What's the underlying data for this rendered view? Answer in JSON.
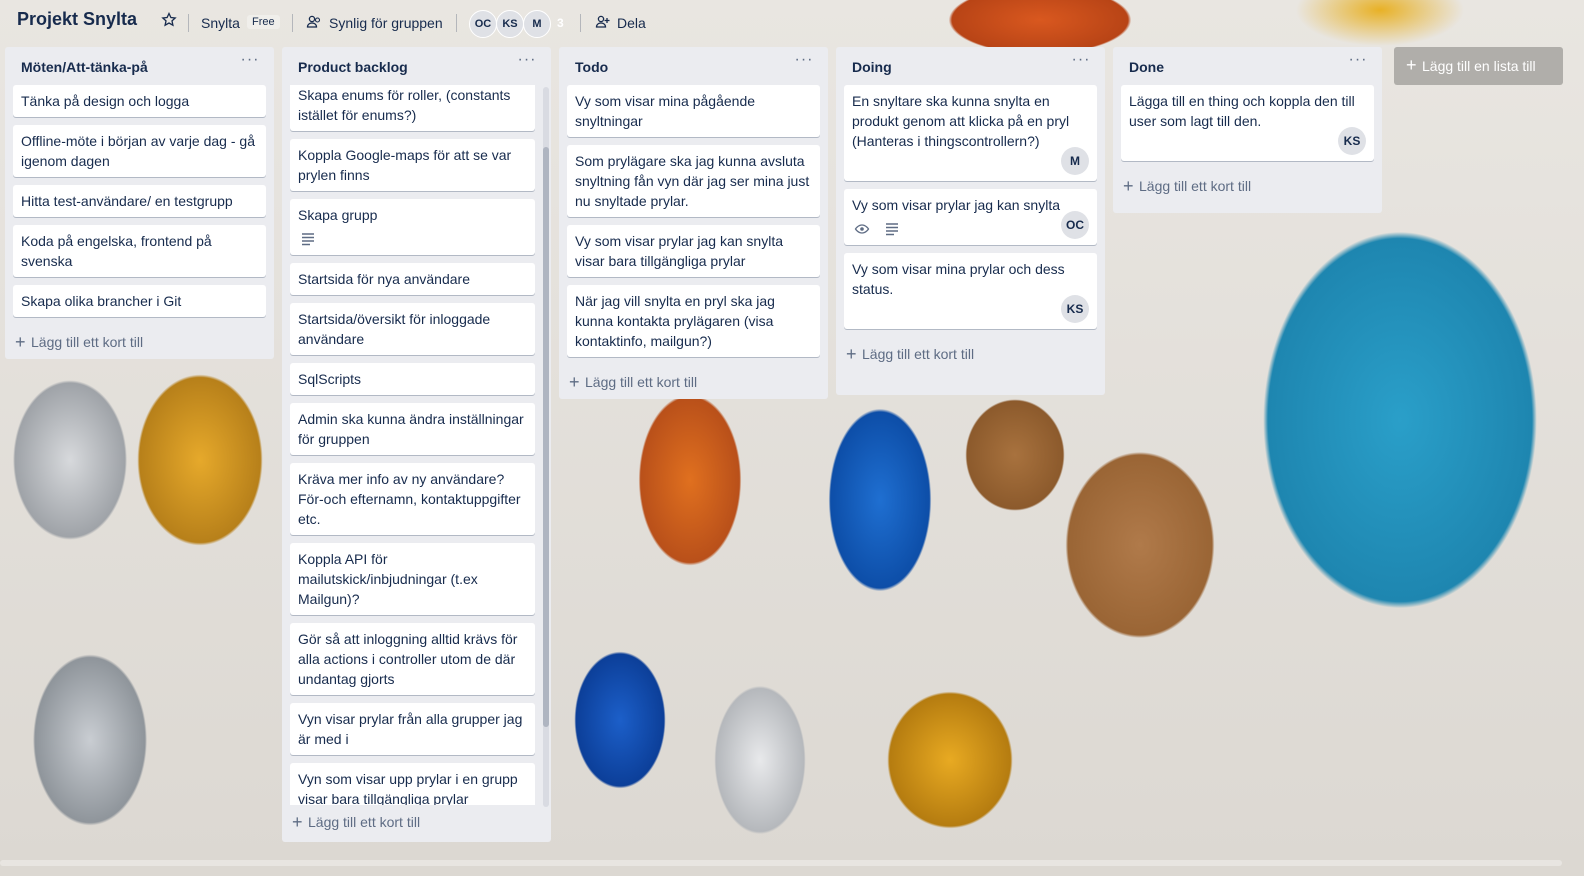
{
  "header": {
    "board_title": "Projekt Snylta",
    "team": "Snylta",
    "plan": "Free",
    "visibility": "Synlig för gruppen",
    "members": [
      "OC",
      "KS",
      "M"
    ],
    "member_count": "3",
    "share": "Dela"
  },
  "lists": [
    {
      "title": "Möten/Att-tänka-på",
      "cards": [
        {
          "text": "Tänka på design och logga"
        },
        {
          "text": "Offline-möte i början av varje dag - gå igenom dagen"
        },
        {
          "text": "Hitta test-användare/ en testgrupp"
        },
        {
          "text": "Koda på engelska, frontend på svenska"
        },
        {
          "text": "Skapa olika brancher i Git"
        }
      ],
      "add_card": "Lägg till ett kort till"
    },
    {
      "title": "Product backlog",
      "cards": [
        {
          "text": "Skapa enums för roller, (constants istället för enums?)"
        },
        {
          "text": "Koppla Google-maps för att se var prylen finns"
        },
        {
          "text": "Skapa grupp",
          "description_icon": "description-icon"
        },
        {
          "text": "Startsida för nya användare"
        },
        {
          "text": "Startsida/översikt för inloggade användare"
        },
        {
          "text": "SqlScripts"
        },
        {
          "text": "Admin ska kunna ändra inställningar för gruppen"
        },
        {
          "text": "Kräva mer info av ny användare? För-och efternamn, kontaktuppgifter etc."
        },
        {
          "text": "Koppla API för mailutskick/inbjudningar (t.ex Mailgun)?"
        },
        {
          "text": "Gör så att inloggning alltid krävs för alla actions i controller utom de där undantag gjorts"
        },
        {
          "text": "Vyn visar prylar från alla grupper jag är med i"
        },
        {
          "text": "Vyn som visar upp prylar i en grupp visar bara tillgängliga prylar"
        }
      ],
      "add_card": "Lägg till ett kort till"
    },
    {
      "title": "Todo",
      "cards": [
        {
          "text": "Vy som visar mina pågående snyltningar"
        },
        {
          "text": "Som prylägare ska jag kunna avsluta snyltning fån vyn där jag ser mina just nu snyltade prylar."
        },
        {
          "text": "Vy som visar prylar jag kan snylta visar bara tillgängliga prylar"
        },
        {
          "text": "När jag vill snylta en pryl ska jag kunna kontakta prylägaren (visa kontaktinfo, mailgun?)"
        }
      ],
      "add_card": "Lägg till ett kort till"
    },
    {
      "title": "Doing",
      "cards": [
        {
          "text": "En snyltare ska kunna snylta en produkt genom att klicka på en pryl (Hanteras i thingscontrollern?)",
          "member": "M"
        },
        {
          "text": "Vy som visar prylar jag kan snylta",
          "member": "OC",
          "watch_icon": "eye-icon",
          "description_icon": "description-icon"
        },
        {
          "text": "Vy som visar mina prylar och dess status.",
          "member": "KS"
        }
      ],
      "add_card": "Lägg till ett kort till"
    },
    {
      "title": "Done",
      "cards": [
        {
          "text": "Lägga till en thing och koppla den till user som lagt till den.",
          "member": "KS"
        }
      ],
      "add_card": "Lägg till ett kort till"
    }
  ],
  "add_list": "Lägg till en lista till",
  "icons": {
    "list_menu": "ellipsis-icon",
    "star": "star-icon",
    "visibility": "people-icon",
    "share": "share-icon",
    "add": "plus-icon"
  }
}
